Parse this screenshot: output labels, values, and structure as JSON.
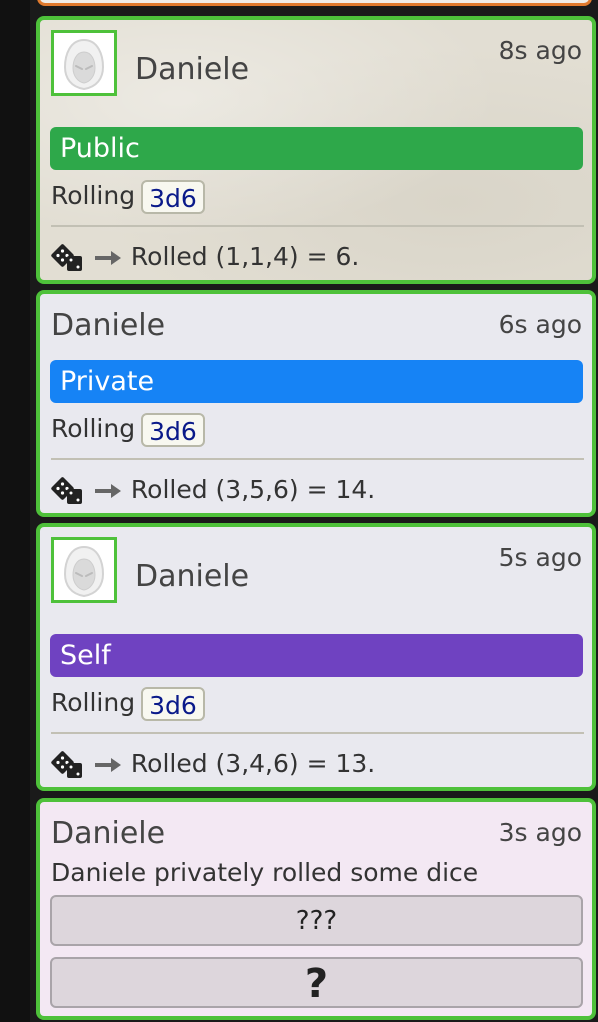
{
  "messages": [
    {
      "sender": "Daniele",
      "time": "8s ago",
      "mode": "Public",
      "rolling_label": "Rolling",
      "formula": "3d6",
      "result": "Rolled (1,1,4) = 6."
    },
    {
      "sender": "Daniele",
      "time": "6s ago",
      "mode": "Private",
      "rolling_label": "Rolling",
      "formula": "3d6",
      "result": "Rolled (3,5,6) = 14."
    },
    {
      "sender": "Daniele",
      "time": "5s ago",
      "mode": "Self",
      "rolling_label": "Rolling",
      "formula": "3d6",
      "result": "Rolled (3,4,6) = 13."
    },
    {
      "sender": "Daniele",
      "time": "3s ago",
      "text": "Daniele privately rolled some dice",
      "button1": "???",
      "button2": "?"
    }
  ],
  "colors": {
    "public": "#2ea84a",
    "private": "#1683f5",
    "self": "#6f42c1",
    "card_border": "#4ec13a",
    "previous_card_border": "#e07a2e"
  },
  "icons": {
    "avatar": "hooded-figure-icon",
    "dice": "dice-icon",
    "arrow": "arrow-right-icon"
  }
}
